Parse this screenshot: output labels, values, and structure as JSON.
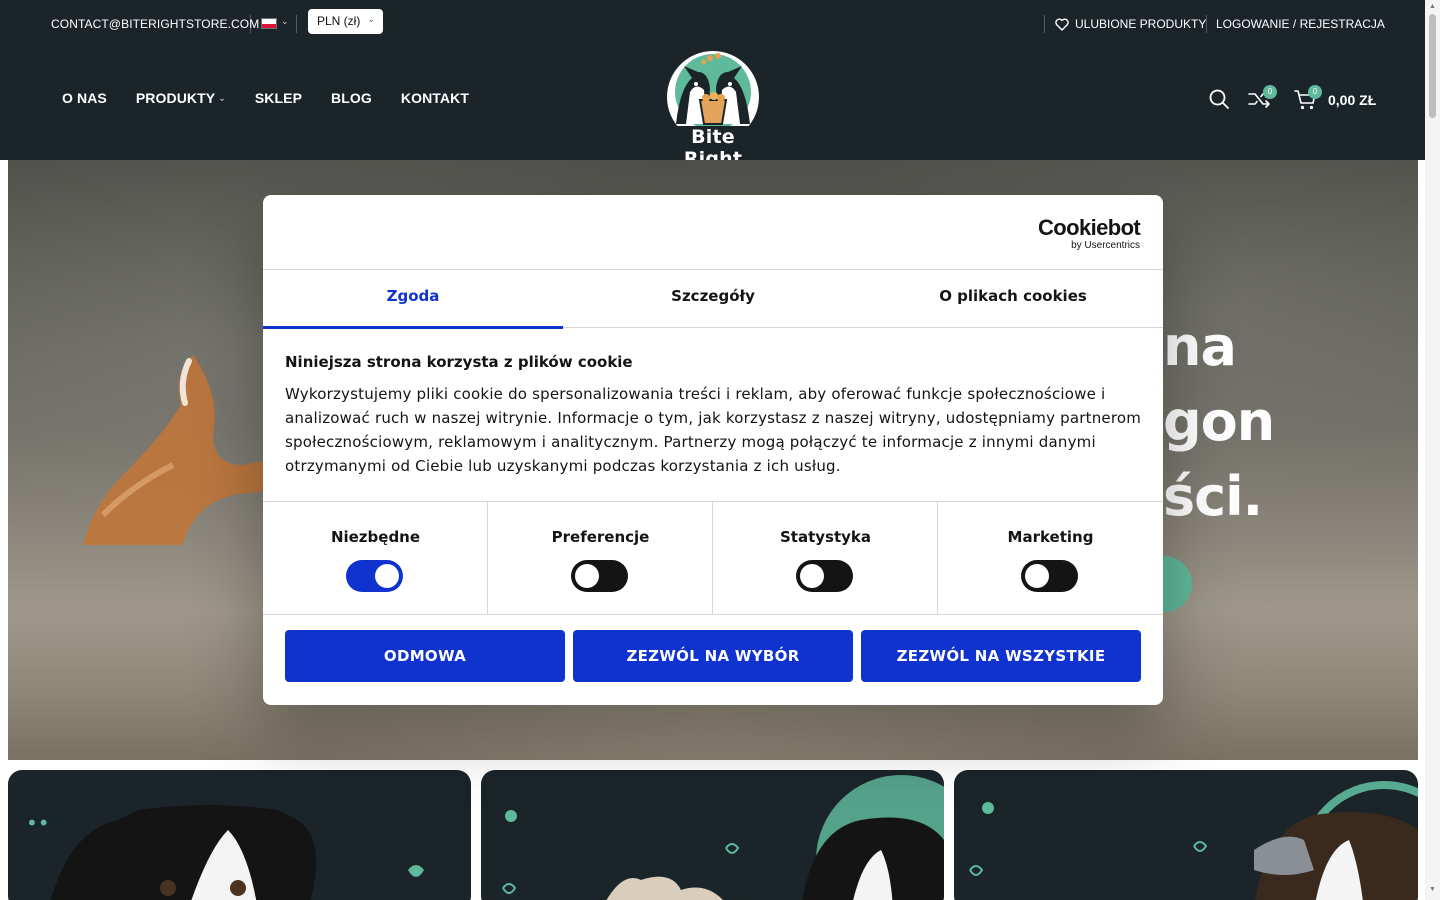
{
  "topbar": {
    "contact_email": "CONTACT@BITERIGHTSTORE.COM",
    "currency": "PLN (zł)",
    "wishlist_label": "ULUBIONE PRODUKTY",
    "login_label": "LOGOWANIE / REJESTRACJA"
  },
  "nav": {
    "items": [
      {
        "label": "O NAS"
      },
      {
        "label": "PRODUKTY"
      },
      {
        "label": "SKLEP"
      },
      {
        "label": "BLOG"
      },
      {
        "label": "KONTAKT"
      }
    ]
  },
  "logo": {
    "text": "Bite Right"
  },
  "header_icons": {
    "compare_count": "0",
    "cart_count": "0",
    "cart_total": "0,00 ZŁ"
  },
  "hero": {
    "line1": "na",
    "line2": "gon",
    "line3": "ści."
  },
  "cookie_dialog": {
    "brand": "Cookiebot",
    "brand_sub": "by Usercentrics",
    "tabs": [
      "Zgoda",
      "Szczegóły",
      "O plikach cookies"
    ],
    "title": "Niniejsza strona korzysta z plików cookie",
    "body": "Wykorzystujemy pliki cookie do spersonalizowania treści i reklam, aby oferować funkcje społecznościowe i analizować ruch w naszej witrynie. Informacje o tym, jak korzystasz z naszej witryny, udostępniamy partnerom społecznościowym, reklamowym i analitycznym. Partnerzy mogą połączyć te informacje z innymi danymi otrzymanymi od Ciebie lub uzyskanymi podczas korzystania z ich usług.",
    "categories": [
      {
        "label": "Niezbędne",
        "enabled": true
      },
      {
        "label": "Preferencje",
        "enabled": false
      },
      {
        "label": "Statystyka",
        "enabled": false
      },
      {
        "label": "Marketing",
        "enabled": false
      }
    ],
    "buttons": {
      "deny": "ODMOWA",
      "allow_selection": "ZEZWÓL NA WYBÓR",
      "allow_all": "ZEZWÓL NA WSZYSTKIE"
    }
  },
  "colors": {
    "header_bg": "#1b2529",
    "accent_green": "#5fb99b",
    "cookiebot_blue": "#1032cf"
  }
}
